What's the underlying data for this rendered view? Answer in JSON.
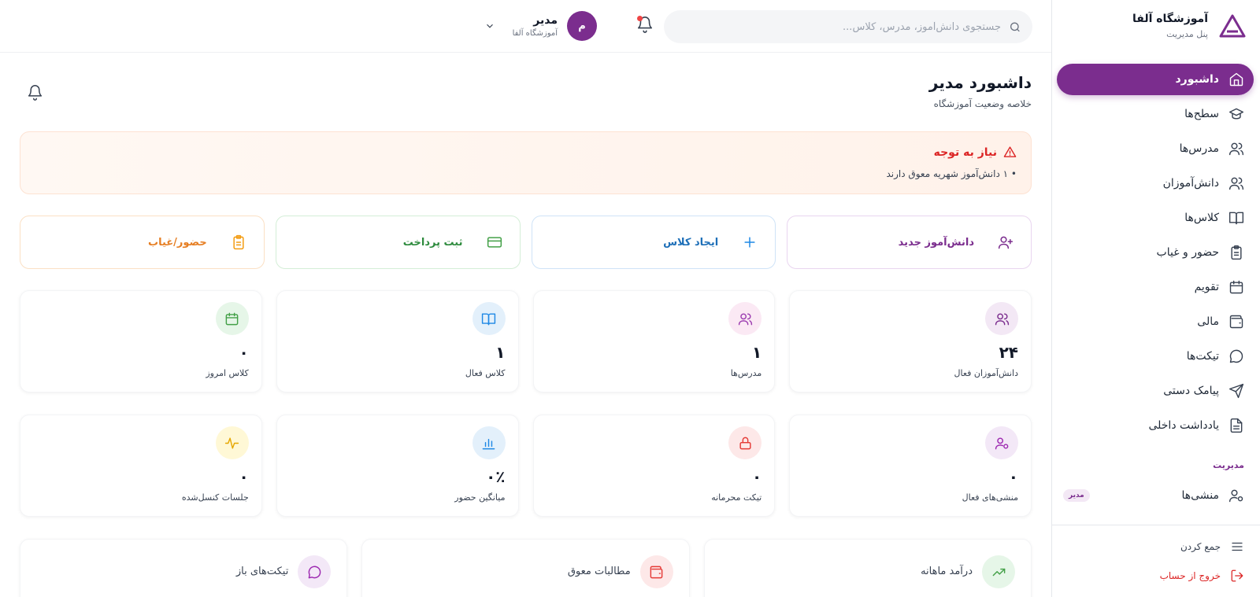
{
  "brand": {
    "title": "آموزشگاه آلفا",
    "subtitle": "پنل مدیریت",
    "accent": "#7b2d8e"
  },
  "search": {
    "placeholder": "جستجوی دانش‌آموز، مدرس، کلاس...",
    "value": ""
  },
  "user": {
    "initial": "م",
    "name": "مدیر",
    "org": "آموزشگاه آلفا"
  },
  "sidebar": {
    "items": [
      {
        "label": "داشبورد",
        "icon": "home-icon",
        "active": true
      },
      {
        "label": "سطح‌ها",
        "icon": "graduation-cap-icon"
      },
      {
        "label": "مدرس‌ها",
        "icon": "users-icon"
      },
      {
        "label": "دانش‌آموزان",
        "icon": "users-icon"
      },
      {
        "label": "کلاس‌ها",
        "icon": "book-icon"
      },
      {
        "label": "حضور و غیاب",
        "icon": "clipboard-icon"
      },
      {
        "label": "تقویم",
        "icon": "calendar-icon"
      },
      {
        "label": "مالی",
        "icon": "wallet-icon"
      },
      {
        "label": "تیکت‌ها",
        "icon": "message-icon"
      },
      {
        "label": "پیامک دستی",
        "icon": "send-icon"
      },
      {
        "label": "یادداشت داخلی",
        "icon": "file-text-icon"
      }
    ],
    "section_label": "مدیریت",
    "secretaries": {
      "label": "منشی‌ها",
      "badge": "مدیر"
    },
    "collapse_label": "جمع کردن",
    "logout_label": "خروج از حساب"
  },
  "page": {
    "title": "داشبورد مدیر",
    "subtitle": "خلاصه وضعیت آموزشگاه"
  },
  "alert": {
    "title": "نیاز به توجه",
    "item": "• ۱ دانش‌آموز شهریه معوق دارند"
  },
  "actions": [
    {
      "label": "دانش‌آموز جدید",
      "icon": "user-plus-icon"
    },
    {
      "label": "ایجاد کلاس",
      "icon": "plus-icon"
    },
    {
      "label": "ثبت پرداخت",
      "icon": "credit-card-icon"
    },
    {
      "label": "حضور/غیاب",
      "icon": "clipboard-icon"
    }
  ],
  "stats_row1": [
    {
      "value": "۲۴",
      "label": "دانش‌آموزان فعال",
      "icon": "users-icon"
    },
    {
      "value": "۱",
      "label": "مدرس‌ها",
      "icon": "users-icon"
    },
    {
      "value": "۱",
      "label": "کلاس فعال",
      "icon": "book-icon"
    },
    {
      "value": "۰",
      "label": "کلاس امروز",
      "icon": "calendar-icon"
    }
  ],
  "stats_row2": [
    {
      "value": "۰",
      "label": "منشی‌های فعال",
      "icon": "user-cog-icon"
    },
    {
      "value": "۰",
      "label": "تیکت محرمانه",
      "icon": "lock-icon"
    },
    {
      "value": "۰٪",
      "label": "میانگین حضور",
      "icon": "bar-chart-icon"
    },
    {
      "value": "۰",
      "label": "جلسات کنسل‌شده",
      "icon": "activity-icon"
    }
  ],
  "bottom_cards": [
    {
      "label": "درآمد ماهانه",
      "icon": "trending-up-icon"
    },
    {
      "label": "مطالبات معوق",
      "icon": "wallet-icon"
    },
    {
      "label": "تیکت‌های باز",
      "icon": "message-icon"
    }
  ]
}
